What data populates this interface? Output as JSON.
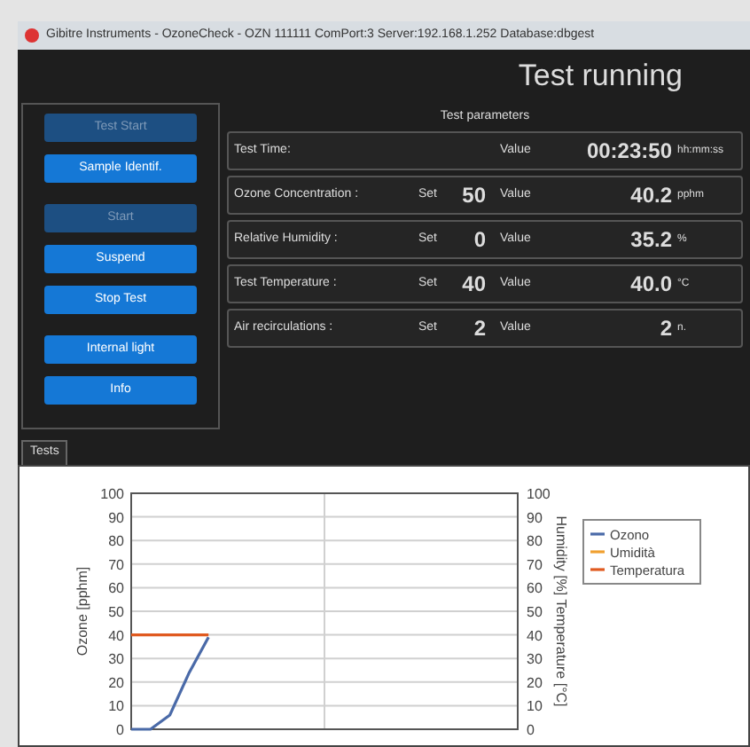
{
  "window": {
    "title": "Gibitre Instruments - OzoneCheck - OZN 111111 ComPort:3 Server:192.168.1.252 Database:dbgest"
  },
  "header": {
    "title": "Test running"
  },
  "button_groups": [
    [
      {
        "label": "Test Start",
        "disabled": true
      },
      {
        "label": "Sample Identif.",
        "disabled": false
      }
    ],
    [
      {
        "label": "Start",
        "disabled": true
      },
      {
        "label": "Suspend",
        "disabled": false
      },
      {
        "label": "Stop Test",
        "disabled": false
      }
    ],
    [
      {
        "label": "Internal light",
        "disabled": false
      },
      {
        "label": "Info",
        "disabled": false
      }
    ]
  ],
  "parameters": {
    "title": "Test parameters",
    "rows": [
      {
        "name": "Test Time:",
        "value_label": "Value",
        "value": "00:23:50",
        "unit": "hh:mm:ss"
      },
      {
        "name": "Ozone Concentration :",
        "set_label": "Set",
        "set": "50",
        "value_label": "Value",
        "value": "40.2",
        "unit": "pphm"
      },
      {
        "name": "Relative Humidity :",
        "set_label": "Set",
        "set": "0",
        "value_label": "Value",
        "value": "35.2",
        "unit": "%"
      },
      {
        "name": "Test Temperature :",
        "set_label": "Set",
        "set": "40",
        "value_label": "Value",
        "value": "40.0",
        "unit": "°C"
      },
      {
        "name": "Air recirculations :",
        "set_label": "Set",
        "set": "2",
        "value_label": "Value",
        "value": "2",
        "unit": "n."
      }
    ]
  },
  "tabs": [
    {
      "label": "Tests",
      "selected": true
    }
  ],
  "chart": {
    "chart_data": {
      "type": "line",
      "ylabel": "Ozone [pphm]",
      "y2label": "Humidity [%] Temperature [°C]",
      "grid": true,
      "legend": "right",
      "series": [
        {
          "name": "Ozono",
          "color": "#4a6aa8",
          "values": [
            0,
            0,
            6,
            24,
            39,
            null,
            null,
            null,
            null,
            null,
            null,
            null,
            null,
            null,
            null,
            null,
            null,
            null,
            null,
            null,
            null
          ]
        },
        {
          "name": "Umidità",
          "color": "#f0a030",
          "values": [
            null,
            null,
            null,
            null,
            null,
            null,
            null,
            null,
            null,
            null,
            null,
            null,
            null,
            null,
            null,
            null,
            null,
            null,
            null,
            null,
            null
          ]
        },
        {
          "name": "Temperatura",
          "color": "#e05a20",
          "values": [
            40,
            40,
            40,
            40,
            40,
            null,
            null,
            null,
            null,
            null,
            null,
            null,
            null,
            null,
            null,
            null,
            null,
            null,
            null,
            null,
            null
          ]
        }
      ],
      "ylim": [
        0,
        100
      ],
      "y2lim": [
        0,
        100
      ],
      "yticks": [
        {
          "value": 0,
          "label": "0"
        },
        {
          "value": 10,
          "label": "10"
        },
        {
          "value": 20,
          "label": "20"
        },
        {
          "value": 30,
          "label": "30"
        },
        {
          "value": 40,
          "label": "40"
        },
        {
          "value": 50,
          "label": "50"
        },
        {
          "value": 60,
          "label": "60"
        },
        {
          "value": 70,
          "label": "70"
        },
        {
          "value": 80,
          "label": "80"
        },
        {
          "value": 90,
          "label": "90"
        },
        {
          "value": 100,
          "label": "100"
        }
      ],
      "y2ticks": [
        {
          "value": 0,
          "label": "0"
        },
        {
          "value": 10,
          "label": "10"
        },
        {
          "value": 20,
          "label": "20"
        },
        {
          "value": 30,
          "label": "30"
        },
        {
          "value": 40,
          "label": "40"
        },
        {
          "value": 50,
          "label": "50"
        },
        {
          "value": 60,
          "label": "60"
        },
        {
          "value": 70,
          "label": "70"
        },
        {
          "value": 80,
          "label": "80"
        },
        {
          "value": 90,
          "label": "90"
        },
        {
          "value": 100,
          "label": "100"
        }
      ]
    }
  }
}
